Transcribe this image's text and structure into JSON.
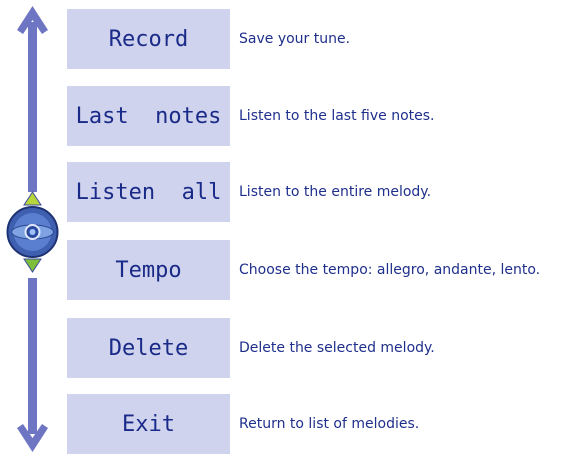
{
  "menu": {
    "items": [
      {
        "label": "Record",
        "description": "Save your tune."
      },
      {
        "label": "Last  notes",
        "description": "Listen to the last five notes."
      },
      {
        "label": "Listen  all",
        "description": "Listen to the entire melody."
      },
      {
        "label": "Tempo",
        "description": "Choose the tempo: allegro, andante, lento."
      },
      {
        "label": "Delete",
        "description": "Delete the selected melody."
      },
      {
        "label": "Exit",
        "description": "Return to list of melodies."
      }
    ]
  },
  "icons": {
    "navigator": "navigation-joystick-icon",
    "arrow_up": "arrow-up-icon",
    "arrow_down": "arrow-down-icon"
  },
  "colors": {
    "button_bg": "#cfd3ed",
    "text": "#1a2a88",
    "arrow": "#6e75c2",
    "joystick_up": "#b8d63c",
    "joystick_down": "#7dbf3a"
  }
}
